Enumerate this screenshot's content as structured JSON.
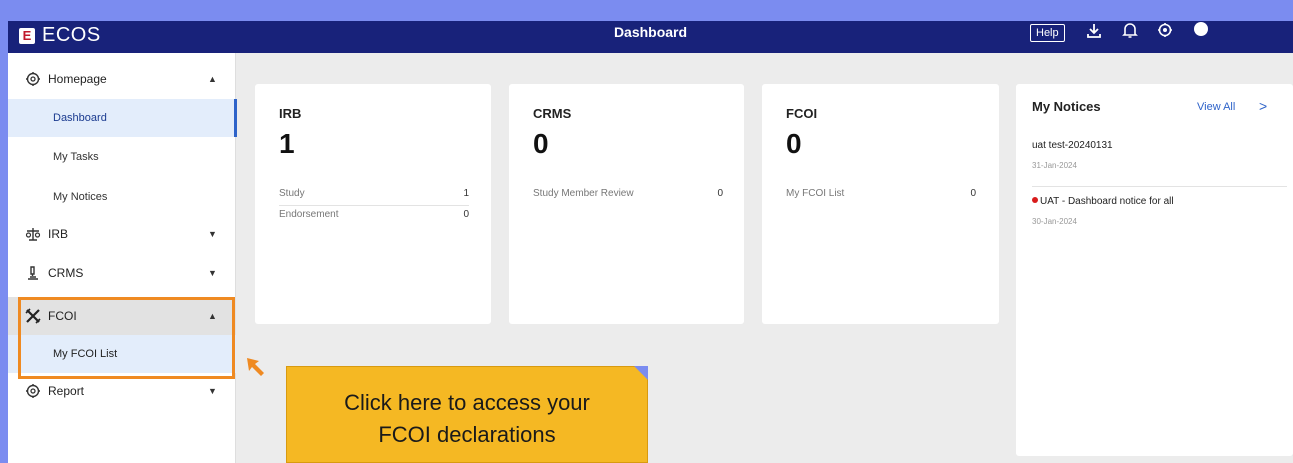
{
  "app": {
    "logo_letter": "E",
    "name": "ECOS",
    "page_title": "Dashboard",
    "help_label": "Help",
    "brand_color": "#18227a"
  },
  "topbar_icons": [
    "download-icon",
    "bell-icon",
    "gear-icon",
    "user-avatar-icon"
  ],
  "sidebar": {
    "groups": [
      {
        "label": "Homepage",
        "icon": "gear-icon",
        "expanded": true,
        "items": [
          {
            "label": "Dashboard",
            "active": true
          },
          {
            "label": "My Tasks"
          },
          {
            "label": "My Notices"
          }
        ]
      },
      {
        "label": "IRB",
        "icon": "scale-icon",
        "expanded": false
      },
      {
        "label": "CRMS",
        "icon": "microscope-icon",
        "expanded": false
      },
      {
        "label": "FCOI",
        "icon": "tools-icon",
        "expanded": true,
        "items": [
          {
            "label": "My FCOI List"
          }
        ]
      },
      {
        "label": "Report",
        "icon": "gear-icon",
        "expanded": false
      }
    ]
  },
  "cards": [
    {
      "title": "IRB",
      "count": "1",
      "rows": [
        {
          "label": "Study",
          "value": "1"
        },
        {
          "label": "Endorsement",
          "value": "0"
        }
      ]
    },
    {
      "title": "CRMS",
      "count": "0",
      "rows": [
        {
          "label": "Study Member Review",
          "value": "0"
        }
      ]
    },
    {
      "title": "FCOI",
      "count": "0",
      "rows": [
        {
          "label": "My FCOI List",
          "value": "0"
        }
      ]
    }
  ],
  "notices": {
    "title": "My Notices",
    "view_all": "View All",
    "items": [
      {
        "title": "uat test-20240131",
        "date": "31-Jan-2024",
        "unread": false
      },
      {
        "title": "UAT - Dashboard notice for all",
        "date": "30-Jan-2024",
        "unread": true
      }
    ]
  },
  "callout": {
    "line1": "Click here to access your",
    "line2": "FCOI declarations",
    "color": "#f5b823",
    "highlight_color": "#ef8a22"
  }
}
